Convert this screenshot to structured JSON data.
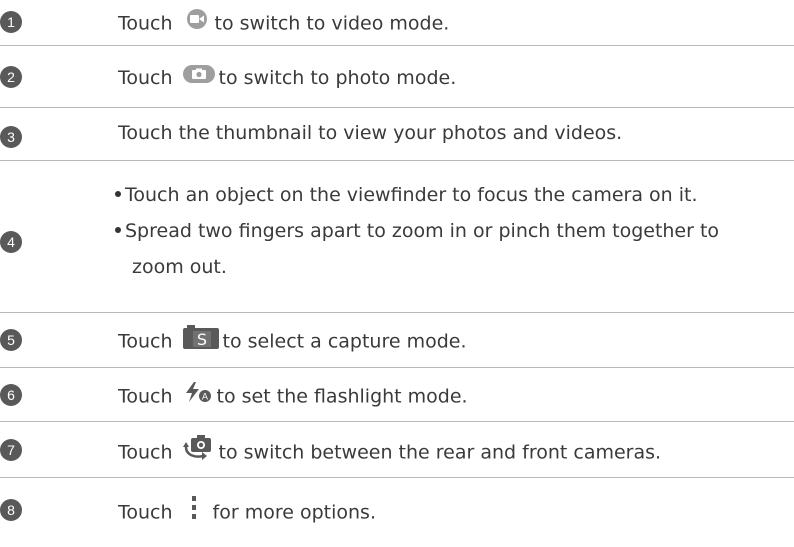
{
  "rows": [
    {
      "num": "1",
      "prefix": "Touch",
      "icon": "video-camera-icon",
      "suffix": "to switch to video mode."
    },
    {
      "num": "2",
      "prefix": "Touch",
      "icon": "photo-camera-icon",
      "suffix": "to switch to photo mode."
    },
    {
      "num": "3",
      "text": "Touch the thumbnail to view your photos and videos."
    },
    {
      "num": "4",
      "bullets": [
        "Touch an object on the viewfinder to focus the camera on it.",
        "Spread two fingers apart to zoom in or pinch them together to",
        "zoom out."
      ]
    },
    {
      "num": "5",
      "prefix": "Touch",
      "icon": "capture-mode-icon",
      "suffix": "to select a capture mode."
    },
    {
      "num": "6",
      "prefix": "Touch",
      "icon": "flash-auto-icon",
      "suffix": "to set the flashlight mode."
    },
    {
      "num": "7",
      "prefix": "Touch",
      "icon": "switch-camera-icon",
      "suffix": "to switch between the rear and front cameras."
    },
    {
      "num": "8",
      "prefix": "Touch",
      "icon": "more-options-icon",
      "suffix": "for more options."
    }
  ],
  "icon_letters": {
    "capture_mode": "S",
    "flash_badge": "A"
  },
  "colors": {
    "badge": "#595959",
    "text": "#3a3a3a",
    "divider": "#b8b8b8",
    "icon_gray": "#9e9e9e"
  }
}
